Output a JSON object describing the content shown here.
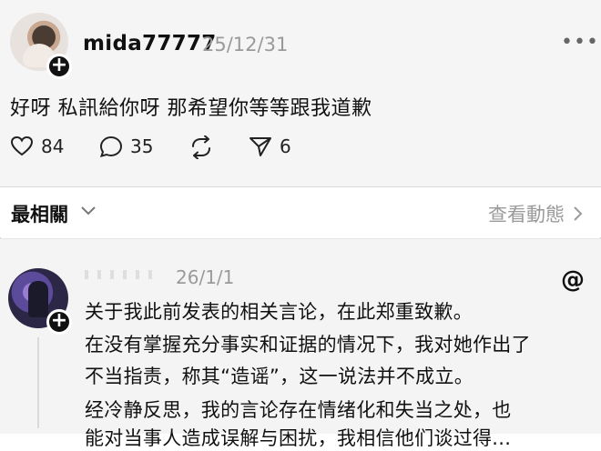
{
  "post": {
    "username": "mida77777",
    "date": "25/12/31",
    "text": "好呀 私訊給你呀 那希望你等等跟我道歉",
    "likes": "84",
    "comments": "35",
    "shares": "6"
  },
  "sort": {
    "label": "最相關",
    "view_activity": "查看動態"
  },
  "reply": {
    "date": "26/1/1",
    "lines": [
      "关于我此前发表的相关言论，在此郑重致歉。",
      "在没有掌握充分事实和证据的情况下，我对她作出了",
      "不当指责，称其“造谣”，这一说法并不成立。",
      "经冷静反思，我的言论存在情绪化和失当之处，也",
      "能对当事人造成误解与困扰，我相信他们谈过得..."
    ]
  },
  "icons": {
    "more": "more-icon",
    "threads": "threads-logo-icon"
  }
}
